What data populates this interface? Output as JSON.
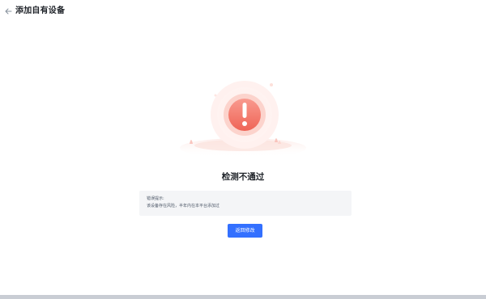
{
  "header": {
    "back_icon": "arrow-left-icon",
    "title": "添加自有设备"
  },
  "result": {
    "status_icon": "exclamation-icon",
    "title": "检测不通过",
    "message_label": "错误提示:",
    "message_detail": "该设备存在风险，半年内在本平台添加过",
    "action_label": "返回修改"
  },
  "colors": {
    "primary": "#3370ff",
    "error": "#f26a5e",
    "message_bg": "#f4f5f7"
  }
}
